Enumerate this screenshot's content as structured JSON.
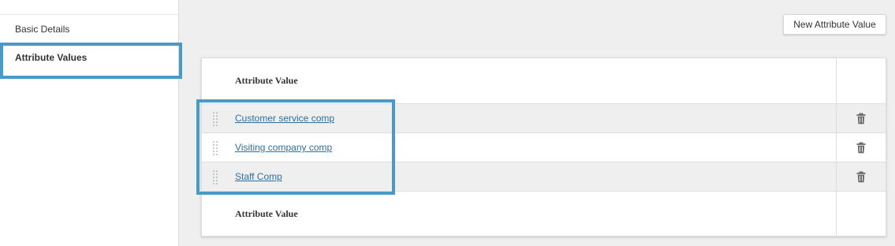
{
  "sidebar": {
    "items": [
      {
        "label": "Basic Details"
      },
      {
        "label": "Attribute Values"
      }
    ]
  },
  "toolbar": {
    "new_button_label": "New Attribute Value"
  },
  "table": {
    "header_label": "Attribute Value",
    "footer_label": "Attribute Value",
    "rows": [
      {
        "value": "Customer service comp"
      },
      {
        "value": "Visiting company comp"
      },
      {
        "value": "Staff Comp"
      }
    ]
  },
  "colors": {
    "highlight": "#4a9ac8",
    "link": "#2d6f9e",
    "shaded_row": "#efefef"
  },
  "icons": {
    "drag": "drag-handle-icon",
    "delete": "trash-icon"
  }
}
